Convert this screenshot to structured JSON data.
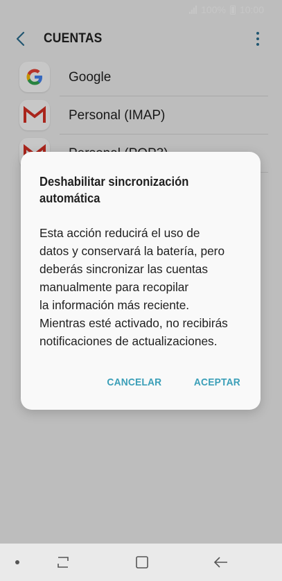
{
  "status_bar": {
    "battery": "100%",
    "time": "10:00"
  },
  "header": {
    "title": "CUENTAS"
  },
  "accounts": [
    {
      "label": "Google",
      "icon": "google-icon"
    },
    {
      "label": "Personal (IMAP)",
      "icon": "gmail-icon"
    },
    {
      "label": "Personal (POP3)",
      "icon": "gmail-icon"
    }
  ],
  "dialog": {
    "title": "Deshabilitar sincronización automática",
    "body_lines": [
      "Esta acción reducirá el uso de",
      "datos y conservará la batería, pero",
      "deberás sincronizar las cuentas",
      "manualmente para recopilar",
      "la información más reciente.",
      "Mientras esté activado, no recibirás",
      "notificaciones de actualizaciones."
    ],
    "cancel_label": "CANCELAR",
    "accept_label": "ACEPTAR"
  },
  "colors": {
    "accent": "#3b9fb8",
    "header_icon": "#2b6f91",
    "gmail_red": "#d93025"
  }
}
